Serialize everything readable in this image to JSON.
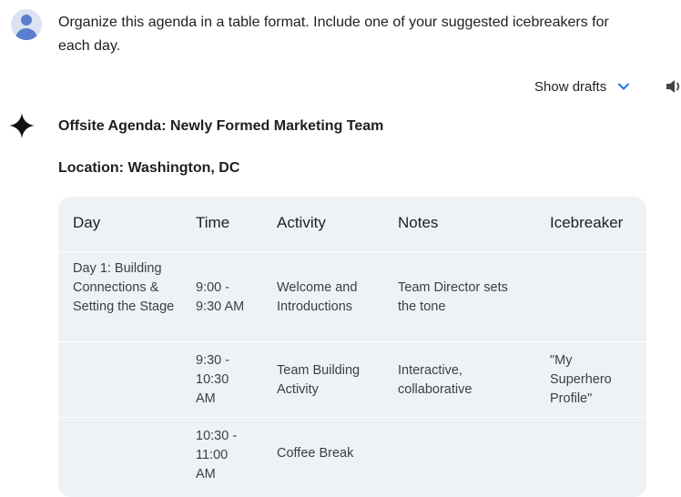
{
  "prompt": {
    "text": "Organize this agenda in a table format. Include one of your suggested icebreakers for each day."
  },
  "toolbar": {
    "show_drafts_label": "Show drafts",
    "chevron_icon": "chevron-down-icon",
    "speaker_icon": "speaker-icon",
    "accent_color": "#1a73e8"
  },
  "response": {
    "title": "Offsite Agenda: Newly Formed Marketing Team",
    "location": "Location: Washington, DC"
  },
  "table": {
    "headers": [
      "Day",
      "Time",
      "Activity",
      "Notes",
      "Icebreaker"
    ],
    "rows": [
      {
        "day": "Day 1: Building Connections & Setting the Stage",
        "time": "9:00 - 9:30 AM",
        "activity": "Welcome and Introductions",
        "notes": "Team Director sets the tone",
        "icebreaker": ""
      },
      {
        "day": "",
        "time": "9:30 - 10:30 AM",
        "activity": "Team Building Activity",
        "notes": "Interactive, collaborative",
        "icebreaker": "\"My Superhero Profile\""
      },
      {
        "day": "",
        "time": "10:30 - 11:00 AM",
        "activity": "Coffee Break",
        "notes": "",
        "icebreaker": ""
      }
    ]
  }
}
